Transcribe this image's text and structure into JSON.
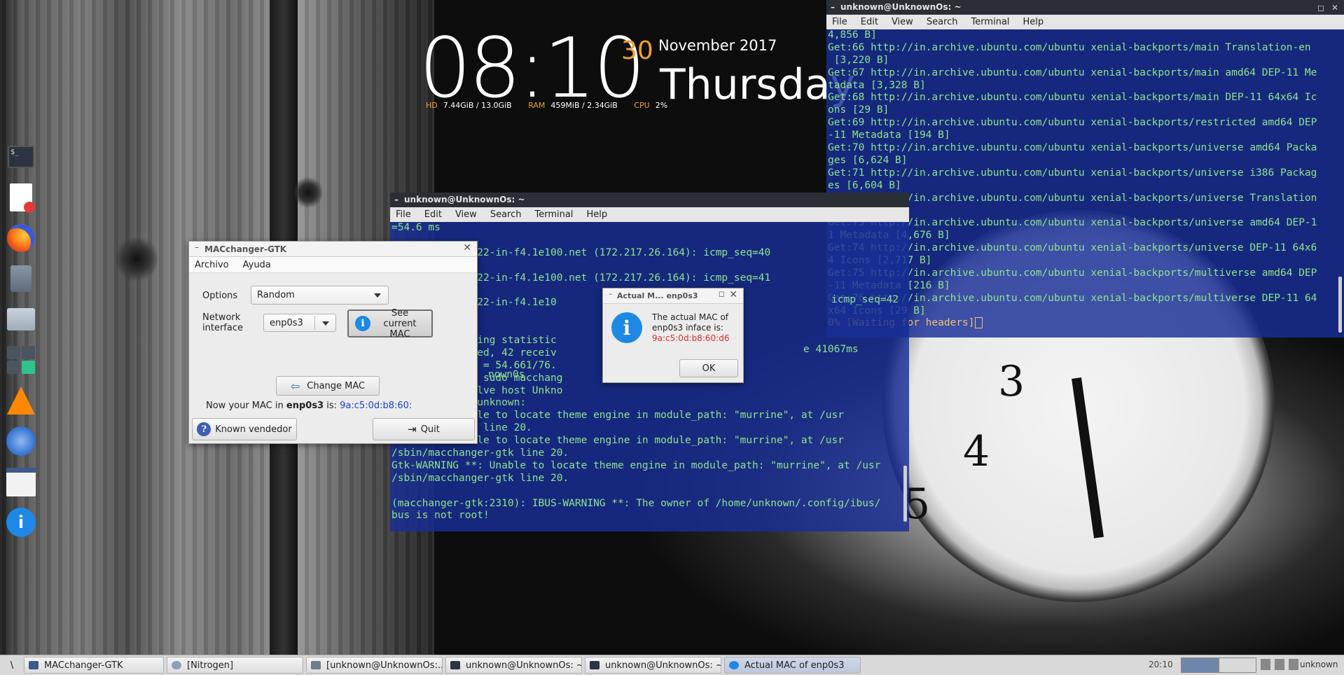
{
  "conky": {
    "time": "08:10",
    "day": "30",
    "month_year": "November 2017",
    "weekday": "Thursday",
    "hd_label": "HD",
    "hd_value": "7.44GiB / 13.0GiB",
    "ram_label": "RAM",
    "ram_value": "459MiB / 2.34GiB",
    "cpu_label": "CPU",
    "cpu_value": "2%"
  },
  "dock": {
    "icons": [
      "terminal-icon",
      "text-editor-icon",
      "firefox-icon",
      "trash-icon",
      "file-manager-icon",
      "calculator-icon",
      "vlc-icon",
      "xfce-settings-icon",
      "window-icon",
      "info-icon"
    ]
  },
  "term_right": {
    "title": "unknown@UnknownOs: ~",
    "menu": [
      "File",
      "Edit",
      "View",
      "Search",
      "Terminal",
      "Help"
    ],
    "lines": [
      "4,856 B]",
      "Get:66 http://in.archive.ubuntu.com/ubuntu xenial-backports/main Translation-en",
      " [3,220 B]",
      "Get:67 http://in.archive.ubuntu.com/ubuntu xenial-backports/main amd64 DEP-11 Me",
      "tadata [3,328 B]",
      "Get:68 http://in.archive.ubuntu.com/ubuntu xenial-backports/main DEP-11 64x64 Ic",
      "ons [29 B]",
      "Get:69 http://in.archive.ubuntu.com/ubuntu xenial-backports/restricted amd64 DEP",
      "-11 Metadata [194 B]",
      "Get:70 http://in.archive.ubuntu.com/ubuntu xenial-backports/universe amd64 Packa",
      "ges [6,624 B]",
      "Get:71 http://in.archive.ubuntu.com/ubuntu xenial-backports/universe i386 Packag",
      "es [6,604 B]",
      "Get:72 http://in.archive.ubuntu.com/ubuntu xenial-backports/universe Translation",
      "-en [3,768 B]",
      "Get:73 http://in.archive.ubuntu.com/ubuntu xenial-backports/universe amd64 DEP-1",
      "1 Metadata [4,676 B]",
      "Get:74 http://in.archive.ubuntu.com/ubuntu xenial-backports/universe DEP-11 64x6",
      "4 Icons [2,717 B]",
      "Get:75 http://in.archive.ubuntu.com/ubuntu xenial-backports/multiverse amd64 DEP",
      "-11 Metadata [216 B]",
      "Get:76 http://in.archive.ubuntu.com/ubuntu xenial-backports/multiverse DEP-11 64",
      "x64 Icons [29 B]"
    ],
    "status_line": "0% [Waiting for headers]"
  },
  "term_mid": {
    "title": "unknown@UnknownOs: ~",
    "menu": [
      "File",
      "Edit",
      "View",
      "Search",
      "Terminal",
      "Help"
    ],
    "lines": [
      "=54.6 ms",
      "",
      "        maa03s22-in-f4.1e100.net (172.217.26.164): icmp_seq=40",
      "",
      "        maa03s22-in-f4.1e100.net (172.217.26.164): icmp_seq=41",
      "",
      "        maa03s22-in-f4.1e10",
      "",
      "",
      "        .com ping statistic",
      "        nsmitted, 42 receiv",
      "        x/mdev = 54.661/76.",
      "        n0s:~$ sudo macchang",
      "        o resolve host Unkno",
      "        d for unknown:",
      "        : Unable to locate theme engine in module_path: \"murrine\", at /usr",
      "        er-gtk line 20.",
      "        : Unable to locate theme engine in module_path: \"murrine\", at /usr",
      "/sbin/macchanger-gtk line 20.",
      "Gtk-WARNING **: Unable to locate theme engine in module_path: \"murrine\", at /usr",
      "/sbin/macchanger-gtk line 20.",
      "",
      "(macchanger-gtk:2310): IBUS-WARNING **: The owner of /home/unknown/.config/ibus/",
      "bus is not root!"
    ],
    "right_fragments": [
      "icmp_seq=42",
      "e 41067ms",
      "nown0s"
    ]
  },
  "macchanger": {
    "title": "MACchanger-GTK",
    "menu": [
      "Archivo",
      "Ayuda"
    ],
    "options_label": "Options",
    "options_value": "Random",
    "interface_label": "Network interface",
    "interface_value": "enp0s3",
    "see_mac_label": "See current MAC",
    "change_mac_label": "Change MAC",
    "status_prefix": "Now your MAC in",
    "status_iface": "enp0s3",
    "status_is": "is:",
    "status_mac": "9a:c5:0d:b8:60:",
    "known_vendor_label": "Known vendedor",
    "quit_label": "Quit",
    "mac_color": "#1a3fd0"
  },
  "dialog": {
    "title": "Actual M... enp0s3",
    "message": "The actual MAC of enp0s3 inface is:",
    "mac": "9a:c5:0d:b8:60:d6",
    "mac_color": "#d32f2f",
    "ok_label": "OK"
  },
  "taskbar": {
    "start_label": "\\",
    "tasks": [
      {
        "label": "MACchanger-GTK",
        "icon": "window-icon"
      },
      {
        "label": "[Nitrogen]",
        "icon": "nitrogen-icon"
      },
      {
        "label": "[unknown@UnknownOs:...",
        "icon": "terminal-icon"
      },
      {
        "label": "unknown@UnknownOs: ~",
        "icon": "terminal-icon"
      },
      {
        "label": "unknown@UnknownOs: ~",
        "icon": "terminal-icon"
      },
      {
        "label": "Actual MAC of enp0s3",
        "icon": "info-icon"
      }
    ],
    "clock": "20:10",
    "user": "unknown"
  },
  "colors": {
    "terminal_bg": "#182e96",
    "terminal_fg": "#8fe28f",
    "accent_orange": "#f0a030",
    "info_blue": "#1e88e5"
  }
}
